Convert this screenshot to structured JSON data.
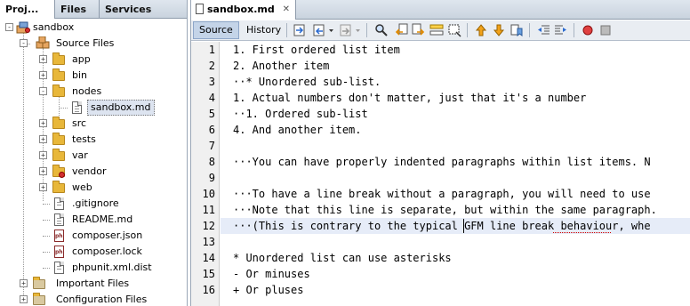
{
  "left_panel": {
    "tabs": [
      {
        "label": "Proj..."
      },
      {
        "label": "Files"
      },
      {
        "label": "Services"
      }
    ],
    "project": "sandbox",
    "source_files": "Source Files",
    "folders": [
      "app",
      "bin",
      "nodes"
    ],
    "open_file": "sandbox.md",
    "more_folders": [
      "src",
      "tests",
      "var",
      "vendor",
      "web"
    ],
    "files": [
      ".gitignore",
      "README.md",
      "composer.json",
      "composer.lock",
      "phpunit.xml.dist"
    ],
    "important_files": "Important Files",
    "configuration_files": "Configuration Files"
  },
  "editor": {
    "tab_title": "sandbox.md",
    "close_glyph": "✕",
    "source_label": "Source",
    "history_label": "History",
    "lines": [
      {
        "n": "1",
        "text": "1. First ordered list item"
      },
      {
        "n": "2",
        "text": "2. Another item"
      },
      {
        "n": "3",
        "text": "··* Unordered sub-list."
      },
      {
        "n": "4",
        "text": "1. Actual numbers don't matter, just that it's a number"
      },
      {
        "n": "5",
        "text": "··1. Ordered sub-list"
      },
      {
        "n": "6",
        "text": "4. And another item."
      },
      {
        "n": "7",
        "text": ""
      },
      {
        "n": "8",
        "text": "···You can have properly indented paragraphs within list items. N"
      },
      {
        "n": "9",
        "text": ""
      },
      {
        "n": "10",
        "text": "···To have a line break without a paragraph, you will need to use"
      },
      {
        "n": "11",
        "text": "···Note that this line is separate, but within the same paragraph."
      },
      {
        "n": "12",
        "text": "···(This is contrary to the typical GFM line break behaviour, whe"
      },
      {
        "n": "13",
        "text": ""
      },
      {
        "n": "14",
        "text": "* Unordered list can use asterisks"
      },
      {
        "n": "15",
        "text": "- Or minuses"
      },
      {
        "n": "16",
        "text": "+ Or pluses"
      }
    ]
  },
  "colors": {
    "accent": "#c4d4e8",
    "current_line": "#e6ecf8",
    "folder": "#e8b73a",
    "error_badge": "#d23030"
  },
  "icons": [
    "project-icon",
    "source-package-icon",
    "folder-icon",
    "document-icon",
    "php-file-icon",
    "error-badge-icon"
  ]
}
